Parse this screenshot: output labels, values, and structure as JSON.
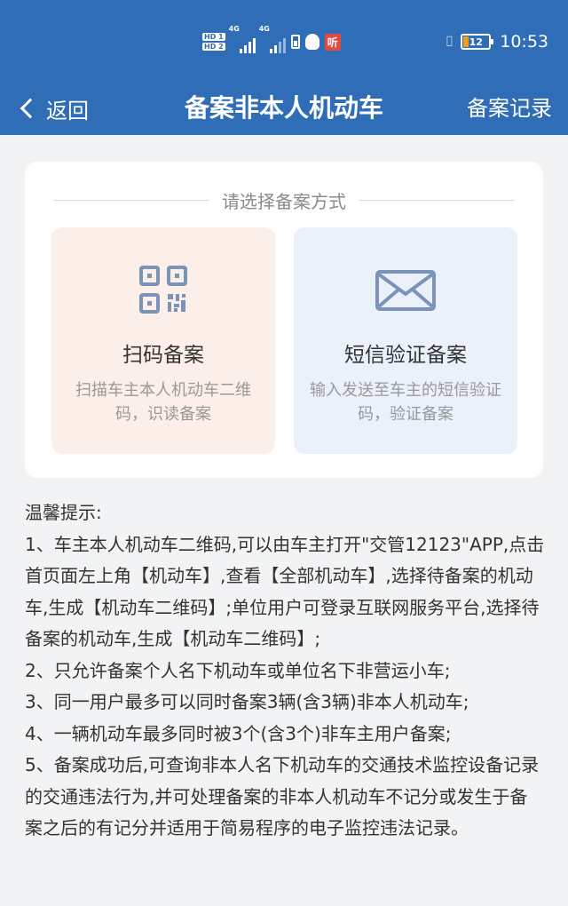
{
  "status": {
    "hd1": "HD 1",
    "hd2": "HD 2",
    "net1": "4G",
    "net2": "4G",
    "ting": "听",
    "battery": "12",
    "time": "10:53"
  },
  "nav": {
    "back_label": "返回",
    "title": "备案非本人机动车",
    "records_label": "备案记录"
  },
  "card": {
    "divider_text": "请选择备案方式",
    "options": [
      {
        "icon": "qr-code-icon",
        "title": "扫码备案",
        "desc": "扫描车主本人机动车二维码，识读备案"
      },
      {
        "icon": "envelope-icon",
        "title": "短信验证备案",
        "desc": "输入发送至车主的短信验证码，验证备案"
      }
    ]
  },
  "tips": {
    "title": "温馨提示:",
    "items": [
      "1、车主本人机动车二维码,可以由车主打开\"交管12123\"APP,点击首页面左上角【机动车】,查看【全部机动车】,选择待备案的机动车,生成【机动车二维码】;单位用户可登录互联网服务平台,选择待备案的机动车,生成【机动车二维码】;",
      "2、只允许备案个人名下机动车或单位名下非营运小车;",
      "3、同一用户最多可以同时备案3辆(含3辆)非本人机动车;",
      "4、一辆机动车最多同时被3个(含3个)非车主用户备案;",
      "5、备案成功后,可查询非本人名下机动车的交通技术监控设备记录的交通违法行为,并可处理备案的非本人机动车不记分或发生于备案之后的有记分并适用于简易程序的电子监控违法记录。"
    ]
  },
  "colors": {
    "primary": "#2f6db7",
    "scan_bg": "#fcefe9",
    "sms_bg": "#eaf1fb",
    "icon": "#7b93b8"
  }
}
